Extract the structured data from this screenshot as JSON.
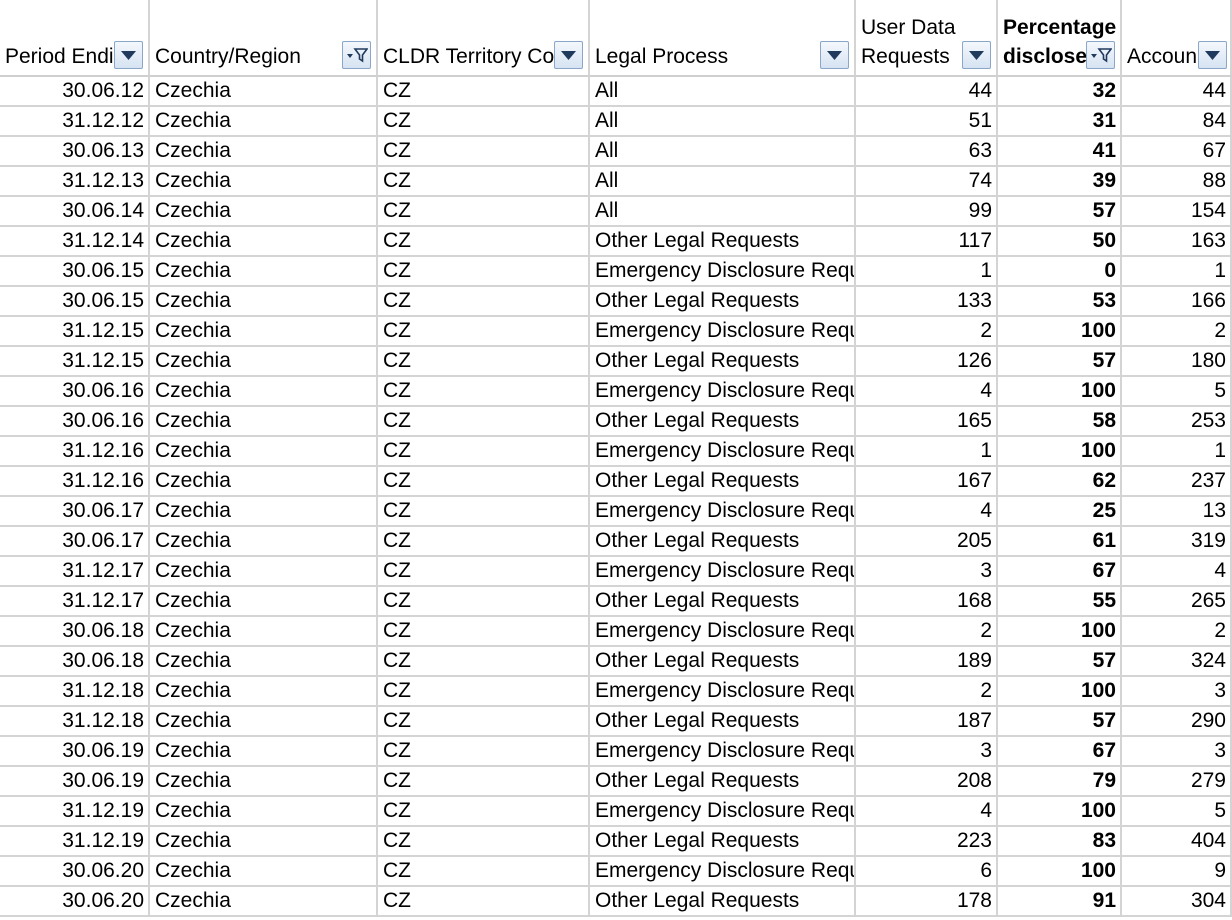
{
  "sheet": {
    "headers": [
      {
        "key": "period",
        "label": "Period Endi",
        "filter": "dropdown"
      },
      {
        "key": "country",
        "label": "Country/Region",
        "filter": "filtered"
      },
      {
        "key": "cldr",
        "label": "CLDR Territory Co",
        "filter": "dropdown"
      },
      {
        "key": "legal",
        "label": "Legal Process",
        "filter": "dropdown"
      },
      {
        "key": "requests",
        "label": "User Data\nRequests",
        "filter": "dropdown"
      },
      {
        "key": "pct",
        "label": "Percentage\ndisclose",
        "filter": "filtered",
        "bold": true
      },
      {
        "key": "accounts",
        "label": "Accoun",
        "filter": "dropdown"
      }
    ],
    "rows": [
      [
        "30.06.12",
        "Czechia",
        "CZ",
        "All",
        "44",
        "32",
        "44"
      ],
      [
        "31.12.12",
        "Czechia",
        "CZ",
        "All",
        "51",
        "31",
        "84"
      ],
      [
        "30.06.13",
        "Czechia",
        "CZ",
        "All",
        "63",
        "41",
        "67"
      ],
      [
        "31.12.13",
        "Czechia",
        "CZ",
        "All",
        "74",
        "39",
        "88"
      ],
      [
        "30.06.14",
        "Czechia",
        "CZ",
        "All",
        "99",
        "57",
        "154"
      ],
      [
        "31.12.14",
        "Czechia",
        "CZ",
        "Other Legal Requests",
        "117",
        "50",
        "163"
      ],
      [
        "30.06.15",
        "Czechia",
        "CZ",
        "Emergency Disclosure Requ",
        "1",
        "0",
        "1"
      ],
      [
        "30.06.15",
        "Czechia",
        "CZ",
        "Other Legal Requests",
        "133",
        "53",
        "166"
      ],
      [
        "31.12.15",
        "Czechia",
        "CZ",
        "Emergency Disclosure Requ",
        "2",
        "100",
        "2"
      ],
      [
        "31.12.15",
        "Czechia",
        "CZ",
        "Other Legal Requests",
        "126",
        "57",
        "180"
      ],
      [
        "30.06.16",
        "Czechia",
        "CZ",
        "Emergency Disclosure Requ",
        "4",
        "100",
        "5"
      ],
      [
        "30.06.16",
        "Czechia",
        "CZ",
        "Other Legal Requests",
        "165",
        "58",
        "253"
      ],
      [
        "31.12.16",
        "Czechia",
        "CZ",
        "Emergency Disclosure Requ",
        "1",
        "100",
        "1"
      ],
      [
        "31.12.16",
        "Czechia",
        "CZ",
        "Other Legal Requests",
        "167",
        "62",
        "237"
      ],
      [
        "30.06.17",
        "Czechia",
        "CZ",
        "Emergency Disclosure Requ",
        "4",
        "25",
        "13"
      ],
      [
        "30.06.17",
        "Czechia",
        "CZ",
        "Other Legal Requests",
        "205",
        "61",
        "319"
      ],
      [
        "31.12.17",
        "Czechia",
        "CZ",
        "Emergency Disclosure Requ",
        "3",
        "67",
        "4"
      ],
      [
        "31.12.17",
        "Czechia",
        "CZ",
        "Other Legal Requests",
        "168",
        "55",
        "265"
      ],
      [
        "30.06.18",
        "Czechia",
        "CZ",
        "Emergency Disclosure Requ",
        "2",
        "100",
        "2"
      ],
      [
        "30.06.18",
        "Czechia",
        "CZ",
        "Other Legal Requests",
        "189",
        "57",
        "324"
      ],
      [
        "31.12.18",
        "Czechia",
        "CZ",
        "Emergency Disclosure Requ",
        "2",
        "100",
        "3"
      ],
      [
        "31.12.18",
        "Czechia",
        "CZ",
        "Other Legal Requests",
        "187",
        "57",
        "290"
      ],
      [
        "30.06.19",
        "Czechia",
        "CZ",
        "Emergency Disclosure Requ",
        "3",
        "67",
        "3"
      ],
      [
        "30.06.19",
        "Czechia",
        "CZ",
        "Other Legal Requests",
        "208",
        "79",
        "279"
      ],
      [
        "31.12.19",
        "Czechia",
        "CZ",
        "Emergency Disclosure Requ",
        "4",
        "100",
        "5"
      ],
      [
        "31.12.19",
        "Czechia",
        "CZ",
        "Other Legal Requests",
        "223",
        "83",
        "404"
      ],
      [
        "30.06.20",
        "Czechia",
        "CZ",
        "Emergency Disclosure Requ",
        "6",
        "100",
        "9"
      ],
      [
        "30.06.20",
        "Czechia",
        "CZ",
        "Other Legal Requests",
        "178",
        "91",
        "304"
      ]
    ]
  },
  "icons": {
    "dropdown": "chevron-down-icon",
    "filtered": "filter-funnel-icon"
  },
  "colors": {
    "grid": "#d4d4d4",
    "filter_button_border": "#8aa6c8",
    "filter_button_top": "#f4f8fd",
    "filter_button_bottom": "#d6e3f2",
    "filter_glyph": "#1f3a5c"
  }
}
